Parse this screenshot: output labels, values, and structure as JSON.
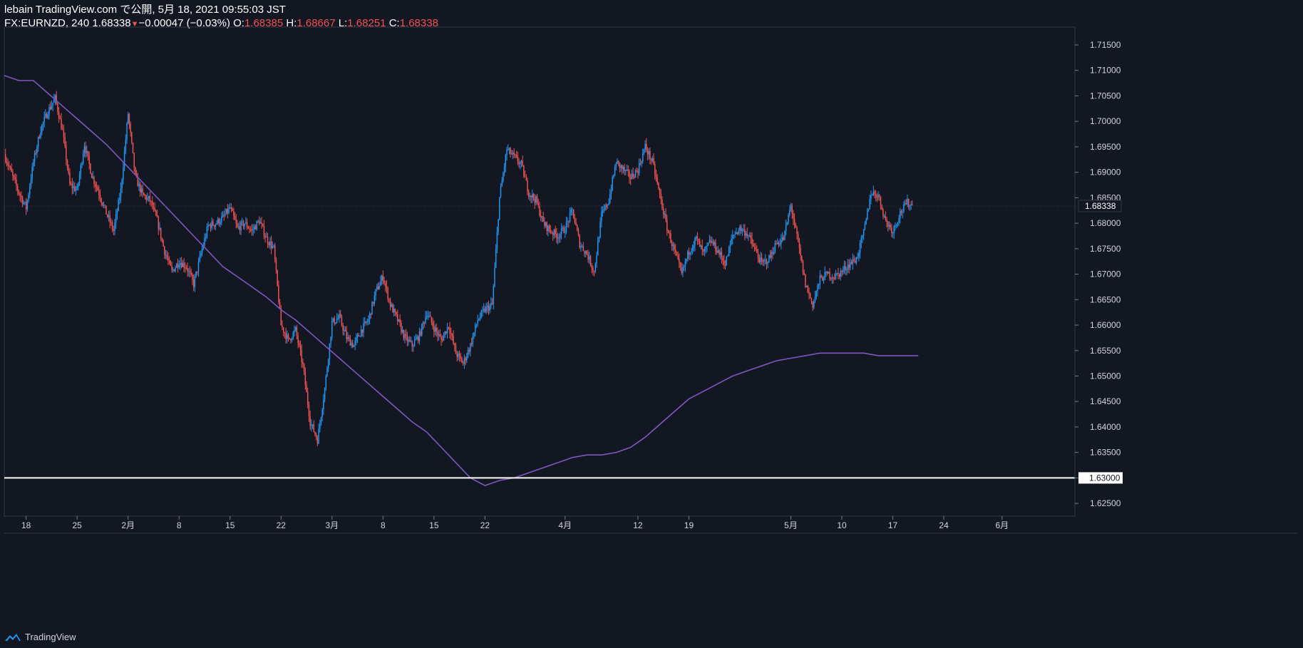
{
  "header": {
    "publish_line": "lebain TradingView.com で公開, 5月 18, 2021 09:55:03 JST",
    "symbol": "FX:EURNZD, 240",
    "last": "1.68338",
    "change": "−0.00047 (−0.03%)",
    "o_label": "O:",
    "o_value": "1.68385",
    "h_label": "H:",
    "h_value": "1.68667",
    "l_label": "L:",
    "l_value": "1.68251",
    "c_label": "C:",
    "c_value": "1.68338"
  },
  "footer": {
    "brand": "TradingView",
    "logo_icon": "tradingview-logo-icon"
  },
  "colors": {
    "background": "#131722",
    "up": "#2196f3",
    "down": "#ef5350",
    "ma": "#7e57c2",
    "horizontal_line": "#ffffff",
    "axis_text": "#d1d4dc"
  },
  "chart_data": {
    "type": "candlestick",
    "symbol": "FX:EURNZD",
    "timeframe": "240",
    "ylim": [
      1.6225,
      1.7185
    ],
    "y_ticks": [
      "1.71500",
      "1.71000",
      "1.70500",
      "1.70000",
      "1.69500",
      "1.69000",
      "1.68500",
      "1.68000",
      "1.67500",
      "1.67000",
      "1.66500",
      "1.66000",
      "1.65500",
      "1.65000",
      "1.64500",
      "1.64000",
      "1.63500",
      "1.63000",
      "1.62500"
    ],
    "x_ticks": [
      {
        "label": "18",
        "x": 1
      },
      {
        "label": "25",
        "x": 8
      },
      {
        "label": "2月",
        "x": 15
      },
      {
        "label": "8",
        "x": 22
      },
      {
        "label": "15",
        "x": 29
      },
      {
        "label": "22",
        "x": 36
      },
      {
        "label": "3月",
        "x": 43
      },
      {
        "label": "8",
        "x": 50
      },
      {
        "label": "15",
        "x": 57
      },
      {
        "label": "22",
        "x": 64
      },
      {
        "label": "4月",
        "x": 75
      },
      {
        "label": "12",
        "x": 85
      },
      {
        "label": "19",
        "x": 92
      },
      {
        "label": "5月",
        "x": 106
      },
      {
        "label": "10",
        "x": 113
      },
      {
        "label": "17",
        "x": 120
      },
      {
        "label": "24",
        "x": 127
      },
      {
        "label": "6月",
        "x": 135
      }
    ],
    "price_path": [
      [
        -2,
        1.6935
      ],
      [
        0,
        1.686
      ],
      [
        1,
        1.683
      ],
      [
        2,
        1.692
      ],
      [
        3,
        1.6985
      ],
      [
        4,
        1.702
      ],
      [
        5,
        1.7045
      ],
      [
        6,
        1.698
      ],
      [
        7,
        1.6875
      ],
      [
        8,
        1.6865
      ],
      [
        9,
        1.6955
      ],
      [
        10,
        1.6895
      ],
      [
        11,
        1.686
      ],
      [
        12,
        1.682
      ],
      [
        13,
        1.6785
      ],
      [
        14,
        1.6865
      ],
      [
        15,
        1.7015
      ],
      [
        16,
        1.689
      ],
      [
        17,
        1.6855
      ],
      [
        18,
        1.6845
      ],
      [
        19,
        1.6805
      ],
      [
        20,
        1.6745
      ],
      [
        21,
        1.6705
      ],
      [
        22,
        1.6725
      ],
      [
        23,
        1.6715
      ],
      [
        24,
        1.668
      ],
      [
        25,
        1.674
      ],
      [
        26,
        1.6795
      ],
      [
        27,
        1.68
      ],
      [
        28,
        1.681
      ],
      [
        29,
        1.683
      ],
      [
        30,
        1.679
      ],
      [
        31,
        1.68
      ],
      [
        32,
        1.6785
      ],
      [
        33,
        1.6805
      ],
      [
        34,
        1.677
      ],
      [
        35,
        1.675
      ],
      [
        36,
        1.66
      ],
      [
        37,
        1.657
      ],
      [
        38,
        1.659
      ],
      [
        39,
        1.652
      ],
      [
        40,
        1.641
      ],
      [
        41,
        1.6375
      ],
      [
        42,
        1.6475
      ],
      [
        43,
        1.6605
      ],
      [
        44,
        1.6615
      ],
      [
        45,
        1.6575
      ],
      [
        46,
        1.656
      ],
      [
        47,
        1.659
      ],
      [
        48,
        1.661
      ],
      [
        49,
        1.6665
      ],
      [
        50,
        1.6695
      ],
      [
        51,
        1.664
      ],
      [
        52,
        1.661
      ],
      [
        53,
        1.6575
      ],
      [
        54,
        1.656
      ],
      [
        55,
        1.658
      ],
      [
        56,
        1.6625
      ],
      [
        57,
        1.6595
      ],
      [
        58,
        1.657
      ],
      [
        59,
        1.66
      ],
      [
        60,
        1.6545
      ],
      [
        61,
        1.6525
      ],
      [
        62,
        1.656
      ],
      [
        63,
        1.661
      ],
      [
        64,
        1.663
      ],
      [
        65,
        1.664
      ],
      [
        66,
        1.685
      ],
      [
        67,
        1.6945
      ],
      [
        68,
        1.693
      ],
      [
        69,
        1.6915
      ],
      [
        70,
        1.686
      ],
      [
        71,
        1.6845
      ],
      [
        72,
        1.68
      ],
      [
        73,
        1.6785
      ],
      [
        74,
        1.6775
      ],
      [
        75,
        1.679
      ],
      [
        76,
        1.6825
      ],
      [
        77,
        1.676
      ],
      [
        78,
        1.674
      ],
      [
        79,
        1.6705
      ],
      [
        80,
        1.6815
      ],
      [
        81,
        1.6845
      ],
      [
        82,
        1.692
      ],
      [
        83,
        1.6905
      ],
      [
        84,
        1.689
      ],
      [
        85,
        1.6905
      ],
      [
        86,
        1.695
      ],
      [
        87,
        1.692
      ],
      [
        88,
        1.6855
      ],
      [
        89,
        1.679
      ],
      [
        90,
        1.6745
      ],
      [
        91,
        1.67
      ],
      [
        92,
        1.6745
      ],
      [
        93,
        1.677
      ],
      [
        94,
        1.674
      ],
      [
        95,
        1.6765
      ],
      [
        96,
        1.6745
      ],
      [
        97,
        1.672
      ],
      [
        98,
        1.6775
      ],
      [
        99,
        1.679
      ],
      [
        100,
        1.678
      ],
      [
        101,
        1.675
      ],
      [
        102,
        1.672
      ],
      [
        103,
        1.673
      ],
      [
        104,
        1.676
      ],
      [
        105,
        1.677
      ],
      [
        106,
        1.6835
      ],
      [
        107,
        1.676
      ],
      [
        108,
        1.668
      ],
      [
        109,
        1.664
      ],
      [
        110,
        1.669
      ],
      [
        111,
        1.67
      ],
      [
        112,
        1.6695
      ],
      [
        113,
        1.6705
      ],
      [
        114,
        1.672
      ],
      [
        115,
        1.673
      ],
      [
        116,
        1.678
      ],
      [
        117,
        1.686
      ],
      [
        118,
        1.6855
      ],
      [
        119,
        1.6805
      ],
      [
        120,
        1.6785
      ],
      [
        121,
        1.682
      ],
      [
        122,
        1.684
      ],
      [
        122.8,
        1.6834
      ]
    ],
    "series": [
      {
        "type": "line",
        "name": "",
        "points": [
          [
            -2,
            1.709
          ],
          [
            0,
            1.708
          ],
          [
            2,
            1.708
          ],
          [
            4,
            1.7055
          ],
          [
            6,
            1.703
          ],
          [
            8,
            1.7005
          ],
          [
            10,
            1.698
          ],
          [
            12,
            1.6955
          ],
          [
            14,
            1.6925
          ],
          [
            16,
            1.6895
          ],
          [
            18,
            1.6865
          ],
          [
            20,
            1.6835
          ],
          [
            22,
            1.6805
          ],
          [
            24,
            1.6775
          ],
          [
            26,
            1.6745
          ],
          [
            28,
            1.6715
          ],
          [
            30,
            1.6695
          ],
          [
            32,
            1.6675
          ],
          [
            34,
            1.6655
          ],
          [
            36,
            1.663
          ],
          [
            38,
            1.661
          ],
          [
            40,
            1.6585
          ],
          [
            42,
            1.656
          ],
          [
            44,
            1.6535
          ],
          [
            46,
            1.651
          ],
          [
            48,
            1.6485
          ],
          [
            50,
            1.646
          ],
          [
            52,
            1.6435
          ],
          [
            54,
            1.641
          ],
          [
            56,
            1.639
          ],
          [
            58,
            1.636
          ],
          [
            60,
            1.633
          ],
          [
            62,
            1.63
          ],
          [
            64,
            1.6285
          ],
          [
            66,
            1.6295
          ],
          [
            68,
            1.63
          ],
          [
            70,
            1.631
          ],
          [
            72,
            1.632
          ],
          [
            74,
            1.633
          ],
          [
            76,
            1.634
          ],
          [
            78,
            1.6345
          ],
          [
            80,
            1.6345
          ],
          [
            82,
            1.635
          ],
          [
            84,
            1.636
          ],
          [
            86,
            1.638
          ],
          [
            88,
            1.6405
          ],
          [
            90,
            1.643
          ],
          [
            92,
            1.6455
          ],
          [
            94,
            1.647
          ],
          [
            96,
            1.6485
          ],
          [
            98,
            1.65
          ],
          [
            100,
            1.651
          ],
          [
            102,
            1.652
          ],
          [
            104,
            1.653
          ],
          [
            106,
            1.6535
          ],
          [
            108,
            1.654
          ],
          [
            110,
            1.6545
          ],
          [
            112,
            1.6545
          ],
          [
            114,
            1.6545
          ],
          [
            116,
            1.6545
          ],
          [
            118,
            1.654
          ],
          [
            120,
            1.654
          ],
          [
            122,
            1.654
          ],
          [
            123.5,
            1.654
          ]
        ]
      }
    ],
    "horizontal_line": 1.63,
    "last_price": 1.68338,
    "last_price_label": "1.68338",
    "horizontal_line_label": "1.63000",
    "xlim": [
      -2,
      145
    ]
  }
}
